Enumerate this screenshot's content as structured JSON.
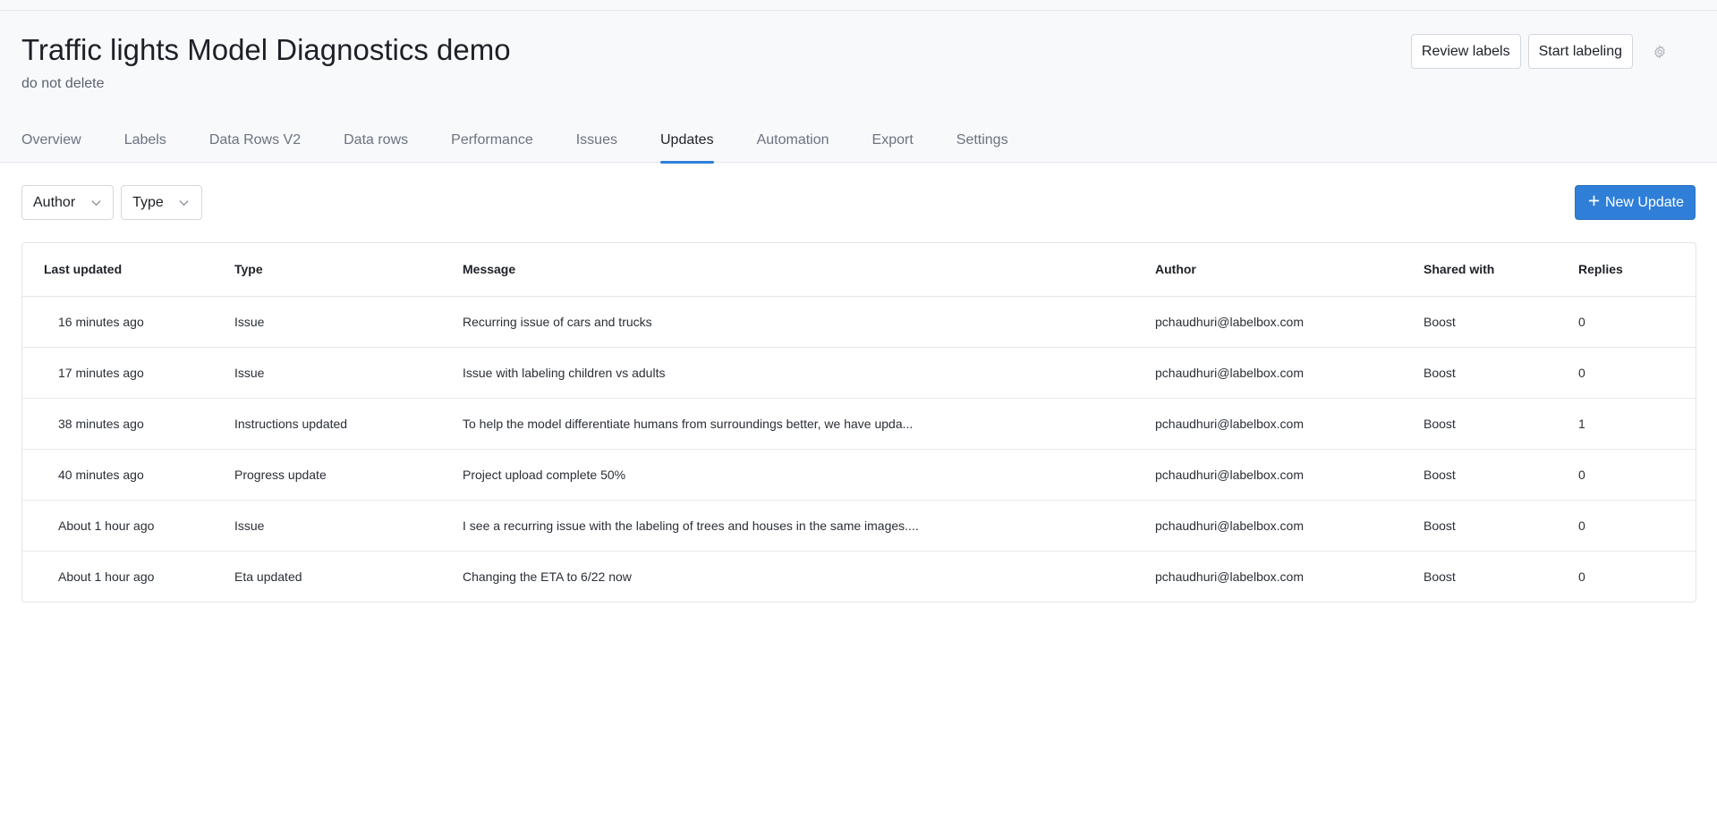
{
  "project": {
    "title": "Traffic lights Model Diagnostics demo",
    "subtitle": "do not delete"
  },
  "actions": {
    "review_label": "Review labels",
    "start_label": "Start labeling",
    "settings_icon": "gear-icon"
  },
  "tabs": [
    {
      "label": "Overview",
      "active": false
    },
    {
      "label": "Labels",
      "active": false
    },
    {
      "label": "Data Rows V2",
      "active": false
    },
    {
      "label": "Data rows",
      "active": false
    },
    {
      "label": "Performance",
      "active": false
    },
    {
      "label": "Issues",
      "active": false
    },
    {
      "label": "Updates",
      "active": true
    },
    {
      "label": "Automation",
      "active": false
    },
    {
      "label": "Export",
      "active": false
    },
    {
      "label": "Settings",
      "active": false
    }
  ],
  "filters": {
    "author": "Author",
    "type": "Type"
  },
  "new_update": {
    "label": "New Update",
    "icon": "plus-icon"
  },
  "table": {
    "columns": [
      "Last updated",
      "Type",
      "Message",
      "Author",
      "Shared with",
      "Replies"
    ],
    "rows": [
      {
        "last_updated": "16 minutes ago",
        "type": "Issue",
        "message": "Recurring issue of cars and trucks",
        "author": "pchaudhuri@labelbox.com",
        "shared_with": "Boost",
        "replies": "0"
      },
      {
        "last_updated": "17 minutes ago",
        "type": "Issue",
        "message": "Issue with labeling children vs adults",
        "author": "pchaudhuri@labelbox.com",
        "shared_with": "Boost",
        "replies": "0"
      },
      {
        "last_updated": "38 minutes ago",
        "type": "Instructions updated",
        "message": "To help the model differentiate humans from surroundings better, we have upda...",
        "author": "pchaudhuri@labelbox.com",
        "shared_with": "Boost",
        "replies": "1"
      },
      {
        "last_updated": "40 minutes ago",
        "type": "Progress update",
        "message": "Project upload complete 50%",
        "author": "pchaudhuri@labelbox.com",
        "shared_with": "Boost",
        "replies": "0"
      },
      {
        "last_updated": "About 1 hour ago",
        "type": "Issue",
        "message": "I see a recurring issue with the labeling of trees and houses in the same images....",
        "author": "pchaudhuri@labelbox.com",
        "shared_with": "Boost",
        "replies": "0"
      },
      {
        "last_updated": "About 1 hour ago",
        "type": "Eta updated",
        "message": "Changing the ETA to 6/22 now",
        "author": "pchaudhuri@labelbox.com",
        "shared_with": "Boost",
        "replies": "0"
      }
    ]
  },
  "colors": {
    "accent": "#2f7fd8",
    "header_bg": "#f8f9fb"
  }
}
